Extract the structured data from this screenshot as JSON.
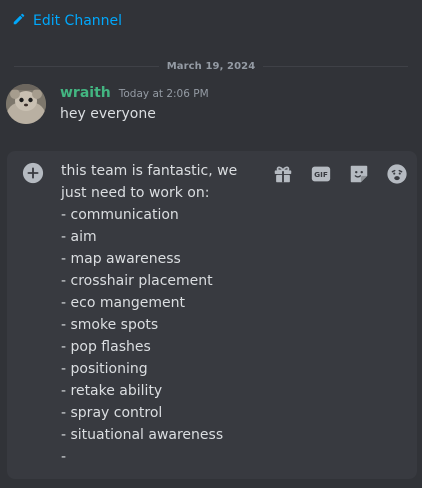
{
  "header": {
    "edit_channel_label": "Edit Channel"
  },
  "divider": {
    "date": "March 19, 2024"
  },
  "message": {
    "username": "wraith",
    "timestamp": "Today at 2:06 PM",
    "content": "hey everyone"
  },
  "composer": {
    "draft_lines": [
      "this team is fantastic, we",
      "just need to work on:",
      "- communication",
      "- aim",
      "- map awareness",
      "- crosshair placement",
      "- eco mangement",
      "- smoke spots",
      "- pop flashes",
      "- positioning",
      "- retake ability",
      "- spray control",
      "- situational awareness",
      "-"
    ],
    "gif_label": "GIF"
  },
  "colors": {
    "accent_link": "#00a8fc",
    "username": "#43b581",
    "background": "#313338",
    "composer_bg": "#383a40"
  },
  "icons": {
    "edit": "pencil-icon",
    "add": "plus-circle-icon",
    "gift": "gift-icon",
    "gif": "gif-icon",
    "sticker": "sticker-icon",
    "emoji": "emoji-icon"
  }
}
